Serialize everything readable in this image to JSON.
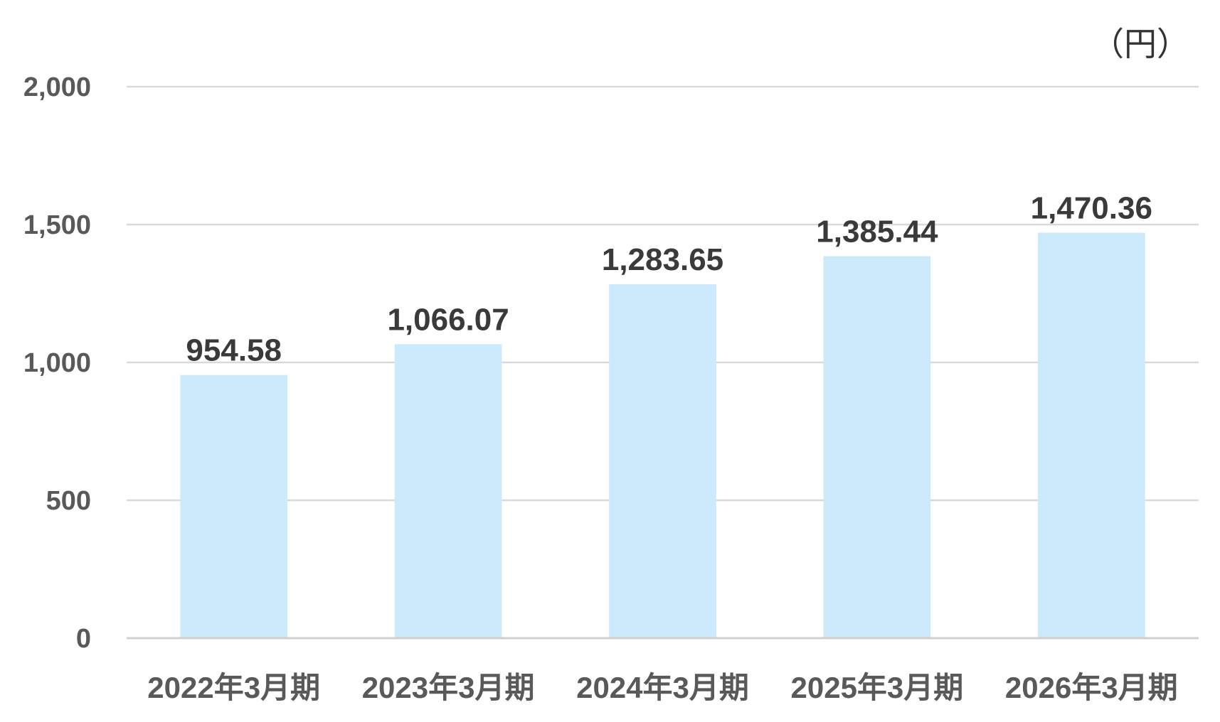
{
  "chart_data": {
    "type": "bar",
    "unit": "（円）",
    "categories": [
      "2022年3月期",
      "2023年3月期",
      "2024年3月期",
      "2025年3月期",
      "2026年3月期"
    ],
    "values": [
      954.58,
      1066.07,
      1283.65,
      1385.44,
      1470.36
    ],
    "value_labels": [
      "954.58",
      "1,066.07",
      "1,283.65",
      "1,385.44",
      "1,470.36"
    ],
    "ylim": [
      0,
      2000
    ],
    "yticks": [
      0,
      500,
      1000,
      1500,
      2000
    ],
    "ytick_labels": [
      "0",
      "500",
      "1,000",
      "1,500",
      "2,000"
    ],
    "grid": true,
    "legend": "none",
    "colors": {
      "bar": "#cdeafc",
      "grid": "#d9d9d9",
      "tick_text": "#595959",
      "label_text": "#3a3a3a"
    }
  }
}
